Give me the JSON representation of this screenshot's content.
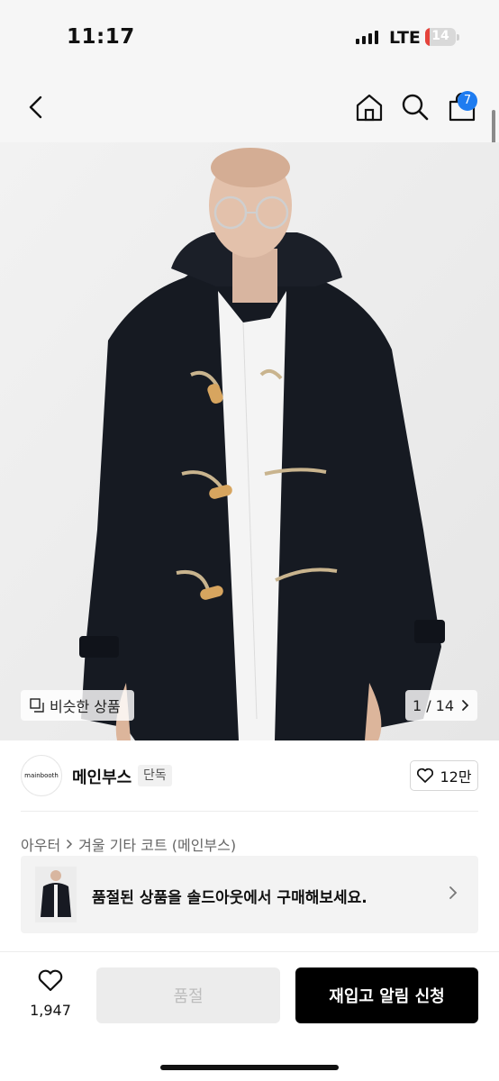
{
  "status_bar": {
    "time": "11:17",
    "network": "LTE",
    "battery": "14",
    "battery_level": 0.14
  },
  "nav": {
    "back_icon": "chevron-left-icon",
    "home_icon": "home-icon",
    "search_icon": "search-icon",
    "cart_icon": "cart-icon",
    "cart_count": "7",
    "accent": "#1f7cf0"
  },
  "gallery": {
    "similar_label": "비슷한 상품",
    "page_indicator": "1 / 14"
  },
  "brand": {
    "logo_text": "mainbooth",
    "name": "메인부스",
    "tag": "단독",
    "likes": "12만"
  },
  "breadcrumb": {
    "category": "아우터",
    "product": "겨울 기타 코트 (메인부스)"
  },
  "soldout_banner": {
    "text": "품절된 상품을 솔드아웃에서 구매해보세요."
  },
  "bottom_bar": {
    "wish_count": "1,947",
    "soldout_label": "품절",
    "restock_label": "재입고 알림 신청"
  }
}
